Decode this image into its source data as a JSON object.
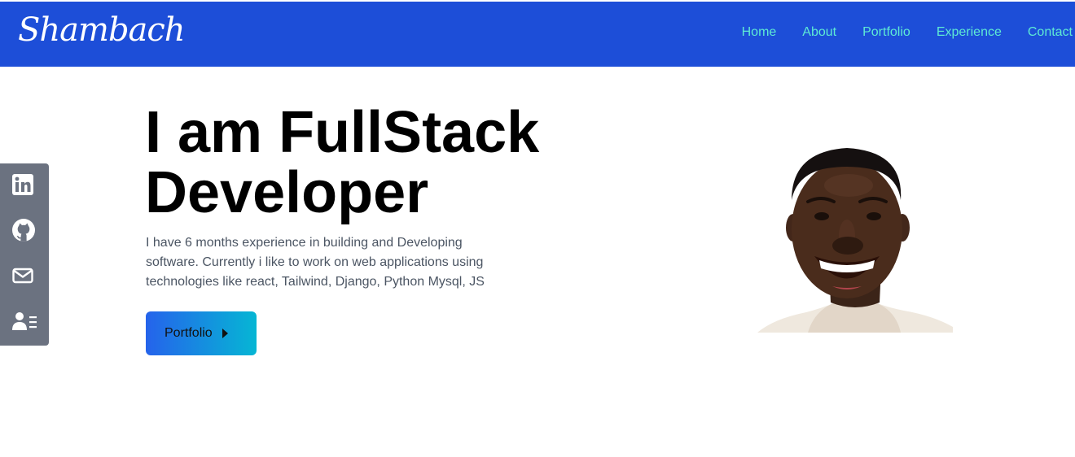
{
  "navbar": {
    "logo": "Shambach",
    "links": [
      "Home",
      "About",
      "Portfolio",
      "Experience",
      "Contact"
    ],
    "bg_color": "#1d4ed8",
    "link_color": "#5eead4"
  },
  "hero": {
    "title_line1": "I am FullStack",
    "title_line2": "Developer",
    "description": "I have 6 months experience in building and Developing software. Currently i like to work on web applications using technologies like react, Tailwind, Django, Python Mysql, JS",
    "button_label": "Portfolio",
    "button_gradient": [
      "#2563eb",
      "#06b6d4"
    ]
  },
  "social": {
    "icons": [
      "linkedin-icon",
      "github-icon",
      "mail-icon",
      "resume-icon"
    ],
    "bg_color": "#6b7280"
  }
}
